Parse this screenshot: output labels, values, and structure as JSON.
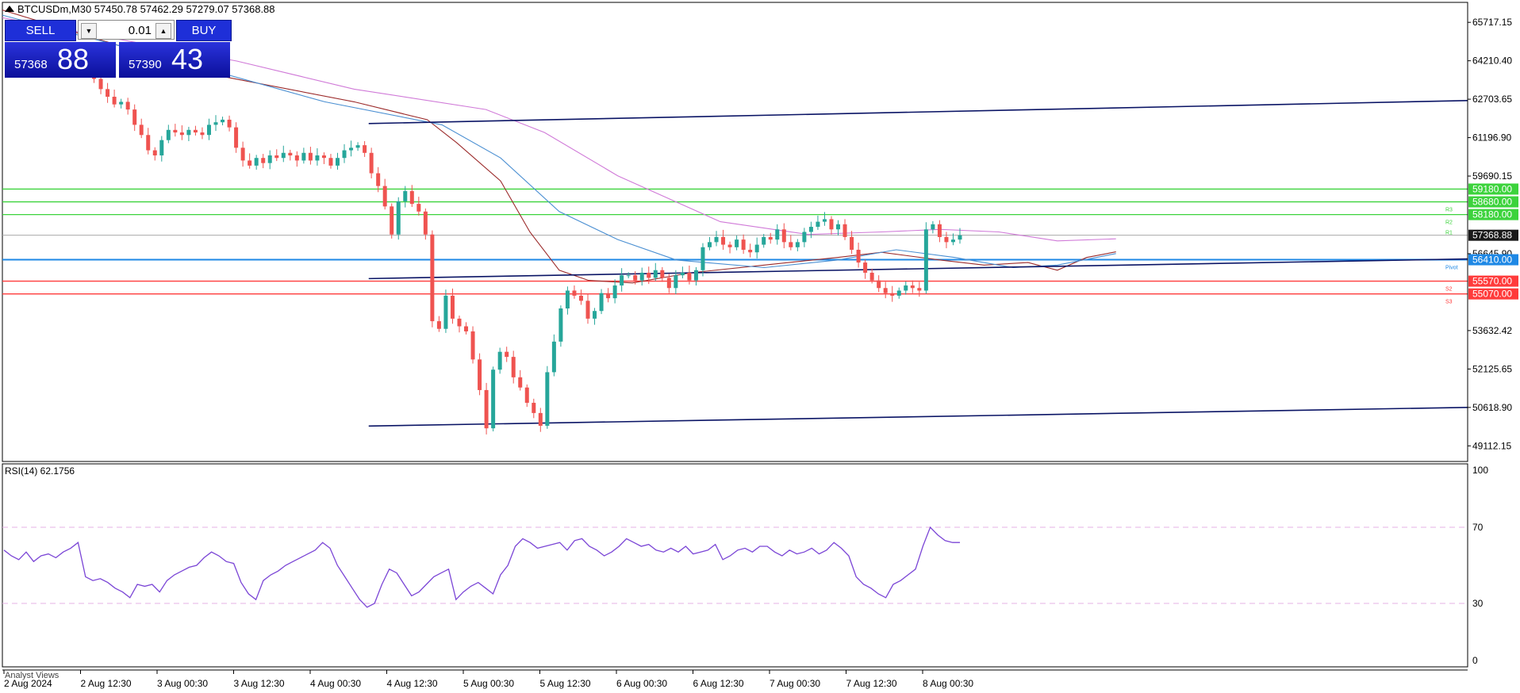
{
  "header": {
    "symbol_line": "BTCUSDm,M30  57450.78 57462.29 57279.07 57368.88"
  },
  "trade_panel": {
    "sell_label": "SELL",
    "buy_label": "BUY",
    "lot_value": "0.01",
    "sell_price_small": "57368",
    "sell_price_big": "88",
    "buy_price_small": "57390",
    "buy_price_big": "43"
  },
  "colors": {
    "bull": "#26a69a",
    "bear": "#ef5350",
    "channel": "#0a1465",
    "resistance": "#3cd33c",
    "pivot": "#1e88e5",
    "support": "#ff3b3b",
    "ma_red": "#9b2a2a",
    "ma_blue": "#4a8fd2",
    "ma_violet": "#d07ad8",
    "rsi_line": "#7b46d6",
    "rsi_level": "#e4b0e6",
    "price_tag_bg": "#1a1a1a"
  },
  "price_axis": {
    "ticks": [
      "65717.15",
      "64210.40",
      "62703.65",
      "61196.90",
      "59690.15",
      "56645.90",
      "53632.42",
      "52125.65",
      "50618.90",
      "49112.15"
    ]
  },
  "levels": [
    {
      "label": "59180.00",
      "tag": "",
      "price": 59180,
      "kind": "resistance"
    },
    {
      "label": "58680.00",
      "tag": "R3",
      "price": 58680,
      "kind": "resistance"
    },
    {
      "label": "58180.00",
      "tag": "R2",
      "price": 58180,
      "kind": "resistance"
    },
    {
      "label": "",
      "tag": "R1",
      "price": 57780,
      "kind": "resistance_tag"
    },
    {
      "label": "56410.00",
      "tag": "Pivot",
      "price": 56410,
      "kind": "pivot"
    },
    {
      "label": "55570.00",
      "tag": "S2",
      "price": 55570,
      "kind": "support"
    },
    {
      "label": "55070.00",
      "tag": "S3",
      "price": 55070,
      "kind": "support"
    }
  ],
  "current_price_label": "57368.88",
  "rsi": {
    "title": "RSI(14) 62.1756",
    "levels": [
      "100",
      "70",
      "30",
      "0"
    ]
  },
  "time_axis": {
    "labels": [
      "2 Aug 2024",
      "2 Aug 12:30",
      "3 Aug 00:30",
      "3 Aug 12:30",
      "4 Aug 00:30",
      "4 Aug 12:30",
      "5 Aug 00:30",
      "5 Aug 12:30",
      "6 Aug 00:30",
      "6 Aug 12:30",
      "7 Aug 00:30",
      "7 Aug 12:30",
      "8 Aug 00:30"
    ]
  },
  "footer_tab": "Analyst Views",
  "chart_data": {
    "type": "candlestick",
    "ylim": [
      48500,
      66500
    ],
    "close_series": [
      63800,
      63500,
      63100,
      62800,
      62500,
      62600,
      62300,
      61700,
      61300,
      60700,
      60500,
      61100,
      61500,
      61400,
      61300,
      61500,
      61400,
      61300,
      61700,
      61800,
      61900,
      61600,
      60800,
      60300,
      60100,
      60400,
      60200,
      60500,
      60400,
      60600,
      60500,
      60300,
      60600,
      60300,
      60500,
      60400,
      60100,
      60400,
      60700,
      60800,
      60900,
      60600,
      59800,
      59300,
      58500,
      57400,
      58700,
      59100,
      58600,
      58300,
      57400,
      54000,
      53700,
      55000,
      54100,
      53800,
      53600,
      52500,
      51300,
      49800,
      52100,
      52800,
      52600,
      51800,
      51400,
      50800,
      50400,
      49900,
      52000,
      53200,
      54500,
      55200,
      55000,
      54800,
      54100,
      54400,
      55100,
      54900,
      55400,
      55800,
      55800,
      55600,
      55900,
      55700,
      56000,
      55700,
      55300,
      55800,
      55900,
      55600,
      56000,
      56900,
      57100,
      57300,
      57000,
      56900,
      57200,
      56800,
      56700,
      57000,
      57300,
      57200,
      57600,
      57100,
      56900,
      57100,
      57500,
      57700,
      57900,
      58000,
      57600,
      57800,
      57300,
      56800,
      56300,
      55900,
      55600,
      55300,
      55100,
      55000,
      55200,
      55400,
      55300,
      55200,
      57600,
      57800,
      57300,
      57100,
      57200,
      57370
    ],
    "ma_red": [
      [
        0,
        66200
      ],
      [
        0.08,
        64800
      ],
      [
        0.15,
        63600
      ],
      [
        0.24,
        62600
      ],
      [
        0.29,
        61900
      ],
      [
        0.31,
        61000
      ],
      [
        0.34,
        59500
      ],
      [
        0.36,
        57500
      ],
      [
        0.38,
        56000
      ],
      [
        0.4,
        55600
      ],
      [
        0.43,
        55500
      ],
      [
        0.47,
        55900
      ],
      [
        0.52,
        56200
      ],
      [
        0.57,
        56500
      ],
      [
        0.6,
        56700
      ],
      [
        0.64,
        56400
      ],
      [
        0.67,
        56200
      ],
      [
        0.7,
        56300
      ],
      [
        0.72,
        56000
      ],
      [
        0.74,
        56500
      ],
      [
        0.76,
        56720
      ]
    ],
    "ma_blue": [
      [
        0,
        66000
      ],
      [
        0.12,
        64200
      ],
      [
        0.17,
        63400
      ],
      [
        0.22,
        62600
      ],
      [
        0.3,
        61700
      ],
      [
        0.34,
        60400
      ],
      [
        0.38,
        58300
      ],
      [
        0.42,
        57200
      ],
      [
        0.46,
        56400
      ],
      [
        0.52,
        56100
      ],
      [
        0.57,
        56400
      ],
      [
        0.61,
        56800
      ],
      [
        0.65,
        56500
      ],
      [
        0.69,
        56100
      ],
      [
        0.72,
        56200
      ],
      [
        0.76,
        56650
      ]
    ],
    "ma_violet": [
      [
        0,
        65900
      ],
      [
        0.16,
        64200
      ],
      [
        0.24,
        63100
      ],
      [
        0.33,
        62300
      ],
      [
        0.37,
        61400
      ],
      [
        0.42,
        59700
      ],
      [
        0.49,
        57900
      ],
      [
        0.55,
        57400
      ],
      [
        0.6,
        57500
      ],
      [
        0.64,
        57600
      ],
      [
        0.68,
        57500
      ],
      [
        0.72,
        57150
      ],
      [
        0.76,
        57230
      ]
    ],
    "channel_upper": [
      [
        0.25,
        61750
      ],
      [
        1.0,
        62650
      ]
    ],
    "channel_mid": [
      [
        0.25,
        55670
      ],
      [
        1.0,
        56440
      ]
    ],
    "channel_lower": [
      [
        0.25,
        49890
      ],
      [
        1.0,
        50620
      ]
    ],
    "rsi_values": [
      58,
      55,
      53,
      57,
      52,
      55,
      56,
      54,
      57,
      59,
      62,
      44,
      42,
      43,
      41,
      38,
      36,
      33,
      40,
      39,
      40,
      36,
      42,
      45,
      47,
      49,
      50,
      54,
      57,
      55,
      52,
      51,
      41,
      35,
      32,
      42,
      45,
      47,
      50,
      52,
      54,
      56,
      58,
      62,
      59,
      50,
      44,
      38,
      32,
      28,
      30,
      40,
      48,
      46,
      40,
      34,
      36,
      40,
      44,
      46,
      48,
      32,
      36,
      39,
      41,
      38,
      35,
      45,
      50,
      60,
      64,
      62,
      59,
      60,
      61,
      62,
      58,
      63,
      64,
      60,
      58,
      55,
      57,
      60,
      64,
      62,
      60,
      61,
      58,
      57,
      59,
      57,
      60,
      56,
      57,
      58,
      61,
      53,
      55,
      58,
      59,
      57,
      60,
      60,
      57,
      55,
      58,
      56,
      57,
      59,
      56,
      58,
      62,
      59,
      55,
      44,
      40,
      38,
      35,
      33,
      40,
      42,
      45,
      48,
      60,
      70,
      66,
      63,
      62,
      62
    ]
  }
}
